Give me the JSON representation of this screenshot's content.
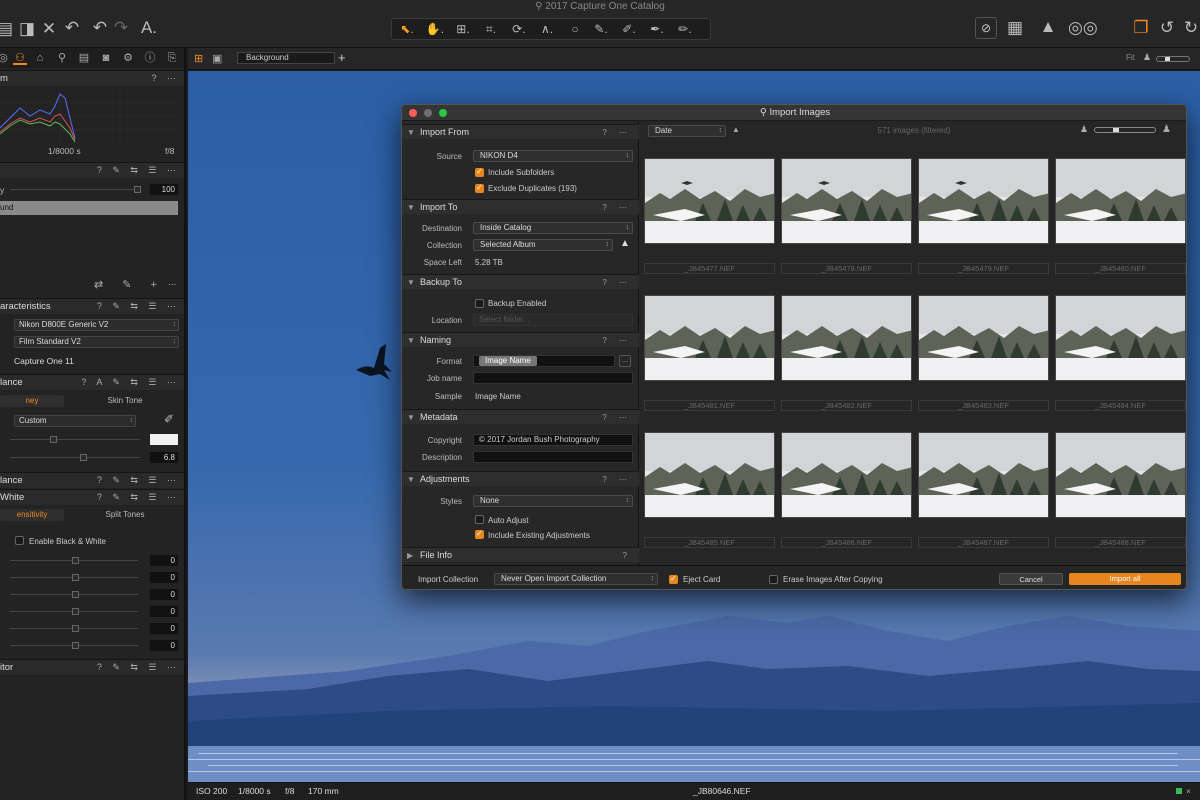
{
  "app": {
    "title": "2017 Capture One Catalog"
  },
  "left_panel": {
    "histogram": {
      "title": "m",
      "shutter": "1/8000 s",
      "aperture": "f/8"
    },
    "layers": {
      "opacity_label": "y",
      "opacity_value": "100",
      "layer_name": "und"
    },
    "base_characteristics": {
      "title": "aracteristics",
      "profile": "Nikon D800E Generic V2",
      "curve": "Film Standard V2",
      "engine": "Capture One 11"
    },
    "white_balance": {
      "title": "lance",
      "tab_active": "ney",
      "tab_other": "Skin Tone",
      "mode": "Custom",
      "value": "6.8"
    },
    "color_balance": {
      "title": "lance"
    },
    "black_white": {
      "title": "White",
      "tab_active": "ensitivity",
      "tab_other": "Split Tones",
      "enable_label": "Enable Black & White",
      "values": [
        "0",
        "0",
        "0",
        "0",
        "0",
        "0"
      ]
    },
    "color_editor": {
      "title": "itor"
    }
  },
  "viewer": {
    "background_label": "Background",
    "fit_label": "Fit"
  },
  "status_bar": {
    "iso": "ISO 200",
    "shutter": "1/8000 s",
    "aperture": "f/8",
    "focal": "170 mm",
    "filename": "_JB80646.NEF"
  },
  "dialog": {
    "title": "Import Images",
    "sort_label": "Date",
    "count_label": "571 images (filtered)",
    "import_from": {
      "title": "Import From",
      "source_label": "Source",
      "source_value": "NIKON D4",
      "subfolders": "Include Subfolders",
      "duplicates": "Exclude Duplicates (193)"
    },
    "import_to": {
      "title": "Import To",
      "destination_label": "Destination",
      "destination_value": "Inside Catalog",
      "collection_label": "Collection",
      "collection_value": "Selected Album",
      "space_label": "Space Left",
      "space_value": "5.28 TB"
    },
    "backup_to": {
      "title": "Backup To",
      "backup_enabled": "Backup Enabled",
      "location_label": "Location",
      "location_placeholder": "Select folder..."
    },
    "naming": {
      "title": "Naming",
      "format_label": "Format",
      "format_token": "Image Name",
      "jobname_label": "Job name",
      "sample_label": "Sample",
      "sample_value": "Image Name"
    },
    "metadata": {
      "title": "Metadata",
      "copyright_label": "Copyright",
      "copyright_value": "© 2017 Jordan Bush Photography",
      "description_label": "Description"
    },
    "adjustments": {
      "title": "Adjustments",
      "styles_label": "Styles",
      "styles_value": "None",
      "auto_adjust": "Auto Adjust",
      "include_existing": "Include Existing Adjustments"
    },
    "file_info": {
      "title": "File Info"
    },
    "thumbnails": [
      "_JB45477.NEF",
      "_JB45478.NEF",
      "_JB45479.NEF",
      "_JB45480.NEF",
      "_JB45481.NEF",
      "_JB45482.NEF",
      "_JB45483.NEF",
      "_JB45484.NEF",
      "_JB45485.NEF",
      "_JB45486.NEF",
      "_JB45487.NEF",
      "_JB45488.NEF"
    ],
    "footer": {
      "import_collection_label": "Import Collection",
      "import_collection_value": "Never Open Import Collection",
      "eject_card": "Eject Card",
      "erase_images": "Erase Images After Copying",
      "cancel": "Cancel",
      "import_all": "Import all"
    }
  },
  "colors": {
    "accent": "#f08a24",
    "sky": "#2f62a8"
  }
}
